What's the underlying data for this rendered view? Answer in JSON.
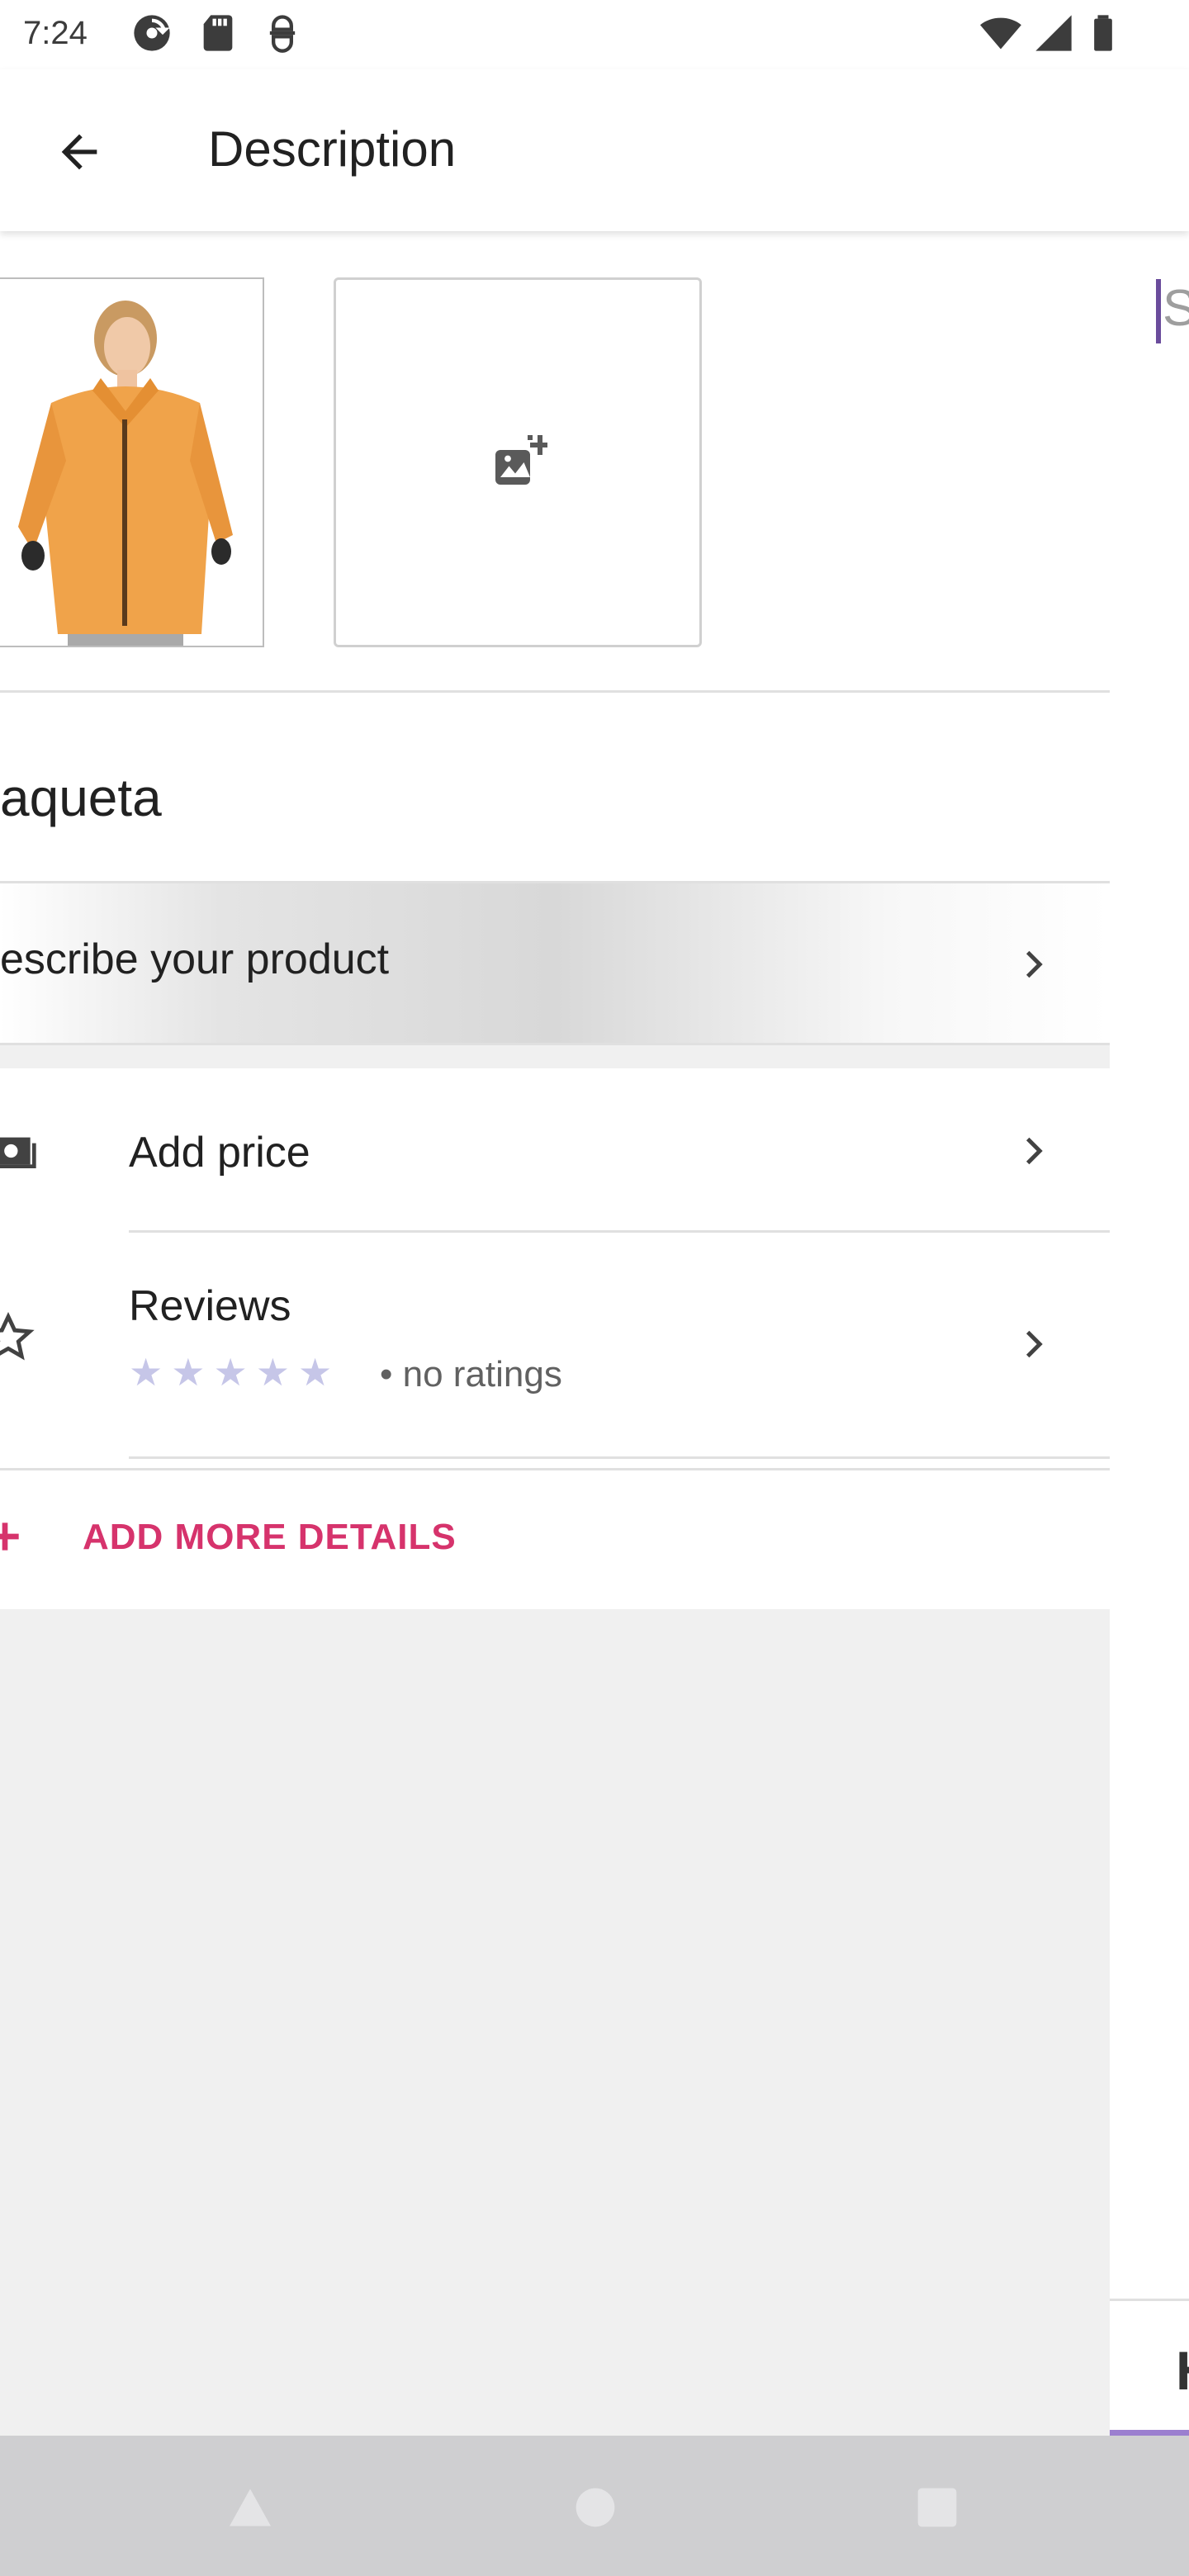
{
  "status_bar": {
    "time": "7:24",
    "left_icons": [
      "sync-icon",
      "sd-card-icon",
      "screen-record-icon"
    ],
    "right_icons": [
      "wifi-icon",
      "signal-icon",
      "battery-icon"
    ]
  },
  "app_bar": {
    "title": "Description",
    "back_icon": "arrow-back-icon"
  },
  "photos": {
    "main_photo": "orange-jacket-photo",
    "add_photo_icon": "add-photo-icon"
  },
  "product": {
    "name": "aqueta",
    "describe_label": "escribe your product"
  },
  "details": {
    "price_label": "Add price",
    "reviews_label": "Reviews",
    "ratings_text": "• no ratings",
    "rating_value": 0,
    "rating_max": 5
  },
  "add_more": {
    "label": "ADD MORE DETAILS"
  },
  "right_panel": {
    "text": "St",
    "bottom_text": "H"
  },
  "nav_bar": {
    "icons": [
      "back-triangle-icon",
      "home-circle-icon",
      "recents-square-icon"
    ]
  },
  "colors": {
    "accent": "#d6336c",
    "star": "#c6c6e8",
    "tab_indicator": "#9b7fcf",
    "cursor": "#6a4c9c"
  }
}
